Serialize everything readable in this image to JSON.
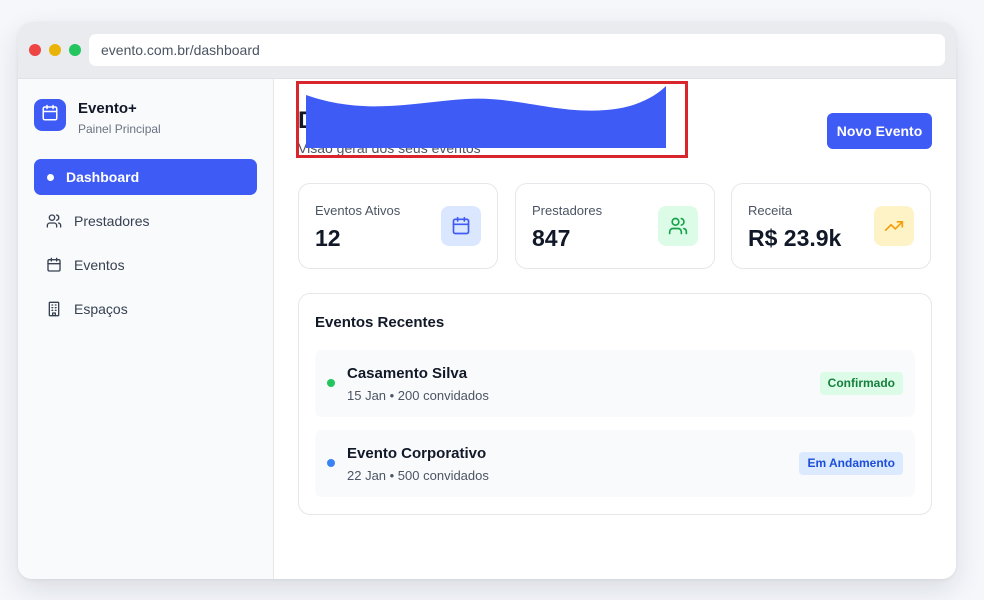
{
  "browser": {
    "url": "evento.com.br/dashboard"
  },
  "sidebar": {
    "brand_name": "Evento+",
    "brand_subtitle": "Painel Principal",
    "brand_icon": "calendar-icon",
    "items": [
      {
        "label": "Dashboard",
        "icon": "bullet",
        "active": true
      },
      {
        "label": "Prestadores",
        "icon": "users-icon",
        "active": false
      },
      {
        "label": "Eventos",
        "icon": "calendar-icon",
        "active": false
      },
      {
        "label": "Espaços",
        "icon": "building-icon",
        "active": false
      }
    ]
  },
  "header": {
    "title": "D",
    "subtitle": "Visão geral dos seus eventos",
    "new_event_label": "Novo Evento"
  },
  "stats": [
    {
      "label": "Eventos Ativos",
      "value": "12",
      "icon": "calendar-icon",
      "color": "#3f5bf6"
    },
    {
      "label": "Prestadores",
      "value": "847",
      "icon": "users-icon",
      "color": "#16a34a"
    },
    {
      "label": "Receita",
      "value": "R$ 23.9k",
      "icon": "trending-up-icon",
      "color": "#f59e0b"
    }
  ],
  "recent": {
    "title": "Eventos Recentes",
    "events": [
      {
        "name": "Casamento Silva",
        "meta": "15 Jan • 200 convidados",
        "status": "Confirmado",
        "dot_color": "#22c55e"
      },
      {
        "name": "Evento Corporativo",
        "meta": "22 Jan • 500 convidados",
        "status": "Em Andamento",
        "dot_color": "#3b82f6"
      }
    ]
  },
  "colors": {
    "accent": "#3f5bf6",
    "redaction_border": "#d8262c"
  }
}
